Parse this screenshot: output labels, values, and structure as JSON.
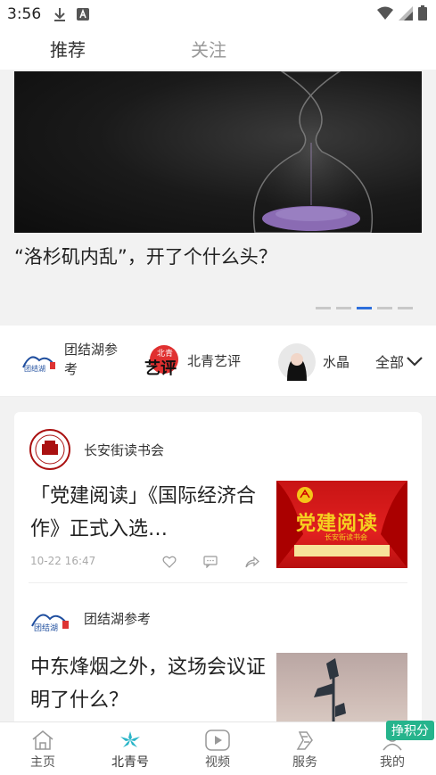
{
  "status_bar": {
    "time": "3:56"
  },
  "top_tabs": [
    {
      "label": "推荐"
    },
    {
      "label": "关注"
    }
  ],
  "banner": {
    "title": "“洛杉矶内乱”，开了个什么头？",
    "dots_count": 5,
    "active_dot": 2
  },
  "follow_row": {
    "items": [
      {
        "label_line1": "团结湖参",
        "label_line2": "考"
      },
      {
        "label": "北青艺评"
      },
      {
        "label": "水晶"
      }
    ],
    "all_label": "全部"
  },
  "articles": [
    {
      "source": "长安街读书会",
      "title": "「党建阅读」《国际经济合作》正式入选…",
      "time": "10-22 16:47",
      "thumb_text": "党建阅读",
      "thumb_sub": "长安街读书会"
    },
    {
      "source": "团结湖参考",
      "title": "中东烽烟之外，这场会议证明了什么？"
    }
  ],
  "bottom_nav": {
    "items": [
      {
        "label": "主页"
      },
      {
        "label": "北青号"
      },
      {
        "label": "视频"
      },
      {
        "label": "服务"
      },
      {
        "label": "我的"
      }
    ],
    "badge": "挣积分"
  },
  "colors": {
    "accent_blue": "#2d6fdc",
    "nav_active": "#2ab5c8",
    "badge_green": "#26b48c"
  }
}
